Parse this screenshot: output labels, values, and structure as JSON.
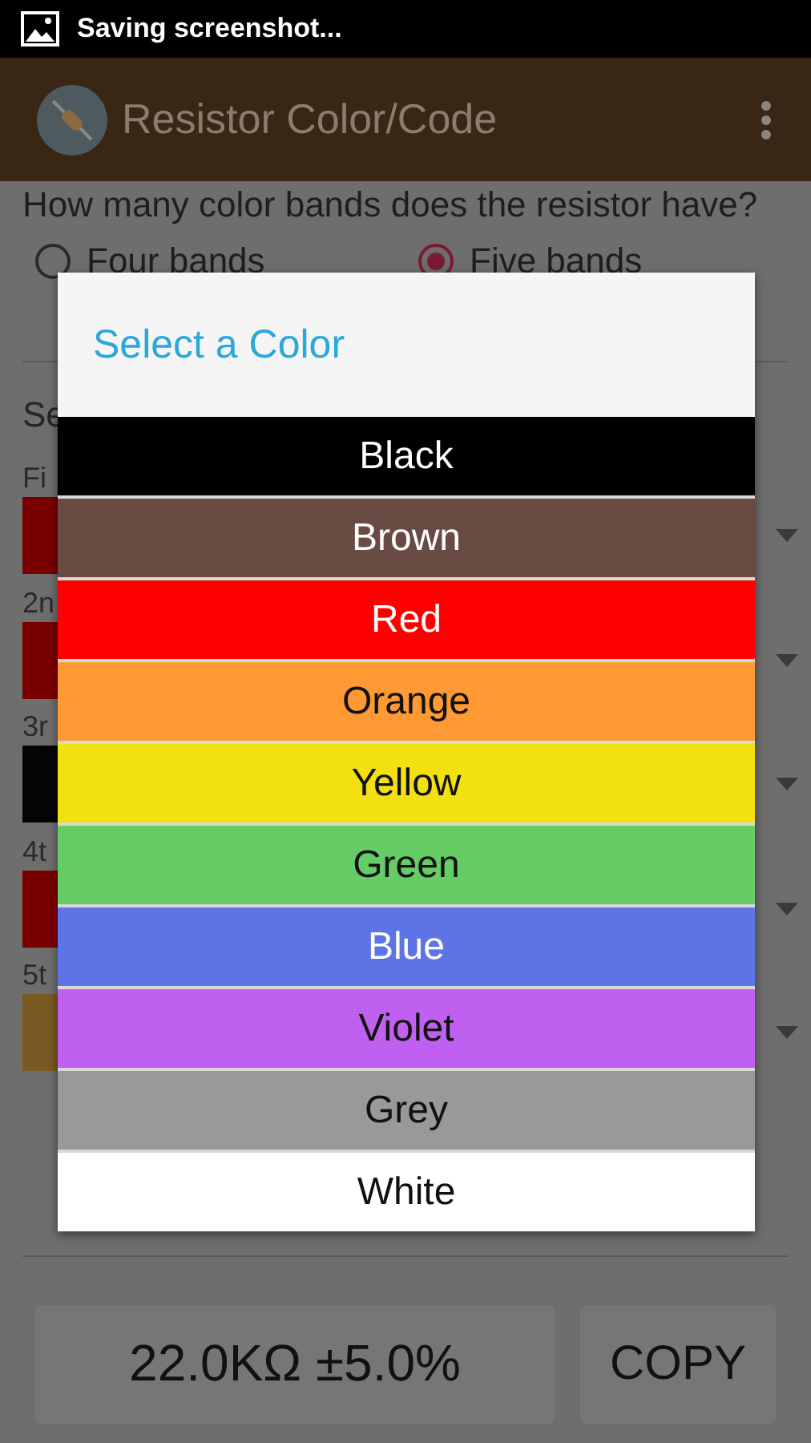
{
  "status_bar": {
    "notification": "Saving screenshot..."
  },
  "app_bar": {
    "title": "Resistor Color/Code"
  },
  "question": "How many color bands does the resistor have?",
  "band_count_options": [
    {
      "label": "Four bands",
      "selected": false
    },
    {
      "label": "Five bands",
      "selected": true
    }
  ],
  "section_label": "Se",
  "bands": [
    {
      "label": "Fi",
      "color": "#7a0000"
    },
    {
      "label": "2n",
      "color": "#7a0000"
    },
    {
      "label": "3r",
      "color": "#050505"
    },
    {
      "label": "4t",
      "color": "#7a0000"
    },
    {
      "label": "5t",
      "color": "#7a5a22"
    }
  ],
  "result": "22.0KΩ ±5.0%",
  "copy_button": "COPY",
  "dialog": {
    "title": "Select a Color",
    "options": [
      {
        "label": "Black",
        "color": "#000000"
      },
      {
        "label": "Brown",
        "color": "#6a4b44"
      },
      {
        "label": "Red",
        "color": "#ff0000"
      },
      {
        "label": "Orange",
        "color": "#ff9933"
      },
      {
        "label": "Yellow",
        "color": "#f2e010"
      },
      {
        "label": "Green",
        "color": "#66cc66"
      },
      {
        "label": "Blue",
        "color": "#5c74e6"
      },
      {
        "label": "Violet",
        "color": "#c060f0"
      },
      {
        "label": "Grey",
        "color": "#999999"
      },
      {
        "label": "White",
        "color": "#ffffff"
      }
    ]
  }
}
